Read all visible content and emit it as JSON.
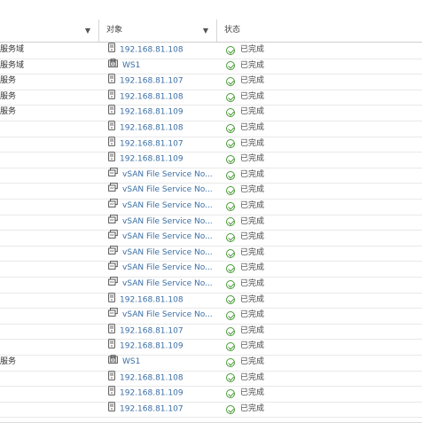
{
  "columns": [
    {
      "label": ""
    },
    {
      "label": "对象"
    },
    {
      "label": "状态"
    }
  ],
  "colors": {
    "status_ok": "#4a9a3a",
    "link": "#3a6ea5"
  },
  "rows": [
    {
      "task": "服务域",
      "obj": "192.168.81.108",
      "icon": "host-icon",
      "status": "已完成"
    },
    {
      "task": "服务域",
      "obj": "WS1",
      "icon": "cluster-icon",
      "status": "已完成"
    },
    {
      "task": "服务",
      "obj": "192.168.81.107",
      "icon": "host-icon",
      "status": "已完成"
    },
    {
      "task": "服务",
      "obj": "192.168.81.108",
      "icon": "host-icon",
      "status": "已完成"
    },
    {
      "task": "服务",
      "obj": "192.168.81.109",
      "icon": "host-icon",
      "status": "已完成"
    },
    {
      "task": "",
      "obj": "192.168.81.108",
      "icon": "host-icon",
      "status": "已完成"
    },
    {
      "task": "",
      "obj": "192.168.81.107",
      "icon": "host-icon",
      "status": "已完成"
    },
    {
      "task": "",
      "obj": "192.168.81.109",
      "icon": "host-icon",
      "status": "已完成"
    },
    {
      "task": "",
      "obj": "vSAN File Service No...",
      "icon": "vm-icon",
      "status": "已完成"
    },
    {
      "task": "",
      "obj": "vSAN File Service No...",
      "icon": "vm-icon",
      "status": "已完成"
    },
    {
      "task": "",
      "obj": "vSAN File Service No...",
      "icon": "vm-icon",
      "status": "已完成"
    },
    {
      "task": "",
      "obj": "vSAN File Service No...",
      "icon": "vm-icon",
      "status": "已完成"
    },
    {
      "task": "",
      "obj": "vSAN File Service No...",
      "icon": "vm-icon",
      "status": "已完成"
    },
    {
      "task": "",
      "obj": "vSAN File Service No...",
      "icon": "vm-icon",
      "status": "已完成"
    },
    {
      "task": "",
      "obj": "vSAN File Service No...",
      "icon": "vm-icon",
      "status": "已完成"
    },
    {
      "task": "",
      "obj": "vSAN File Service No...",
      "icon": "vm-icon",
      "status": "已完成"
    },
    {
      "task": "",
      "obj": "192.168.81.108",
      "icon": "host-icon",
      "status": "已完成"
    },
    {
      "task": "",
      "obj": "vSAN File Service No...",
      "icon": "vm-icon",
      "status": "已完成"
    },
    {
      "task": "",
      "obj": "192.168.81.107",
      "icon": "host-icon",
      "status": "已完成"
    },
    {
      "task": "",
      "obj": "192.168.81.109",
      "icon": "host-icon",
      "status": "已完成"
    },
    {
      "task": "服务",
      "obj": "WS1",
      "icon": "cluster-icon",
      "status": "已完成"
    },
    {
      "task": "",
      "obj": "192.168.81.108",
      "icon": "host-icon",
      "status": "已完成"
    },
    {
      "task": "",
      "obj": "192.168.81.109",
      "icon": "host-icon",
      "status": "已完成"
    },
    {
      "task": "",
      "obj": "192.168.81.107",
      "icon": "host-icon",
      "status": "已完成"
    }
  ]
}
